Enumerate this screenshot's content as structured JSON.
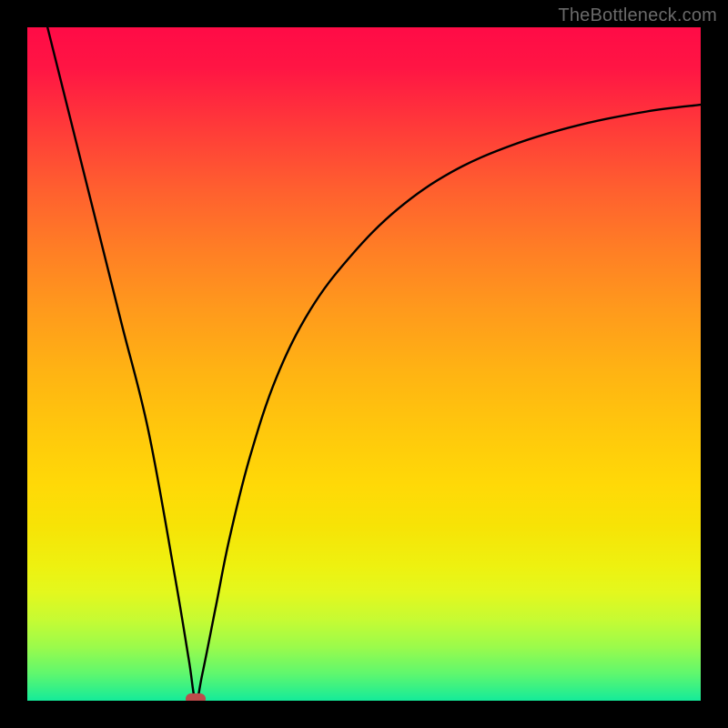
{
  "watermark": "TheBottleneck.com",
  "chart_data": {
    "type": "line",
    "title": "",
    "xlabel": "",
    "ylabel": "",
    "xlim": [
      0,
      100
    ],
    "ylim": [
      0,
      100
    ],
    "grid": false,
    "legend": false,
    "series": [
      {
        "name": "curve",
        "x": [
          3,
          6,
          10,
          14,
          18,
          22,
          24,
          25,
          26,
          28,
          30,
          33,
          37,
          42,
          48,
          55,
          63,
          72,
          82,
          92,
          100
        ],
        "y": [
          100,
          88,
          72,
          56,
          40,
          18,
          6,
          0,
          4,
          14,
          24,
          36,
          48,
          58,
          66,
          73,
          78.5,
          82.5,
          85.5,
          87.5,
          88.5
        ]
      }
    ],
    "minimum_marker": {
      "x": 25,
      "y": 0,
      "color": "#bd4b4b"
    },
    "background_gradient": {
      "top": "#ff0b46",
      "bottom": "#14eb9a"
    }
  }
}
